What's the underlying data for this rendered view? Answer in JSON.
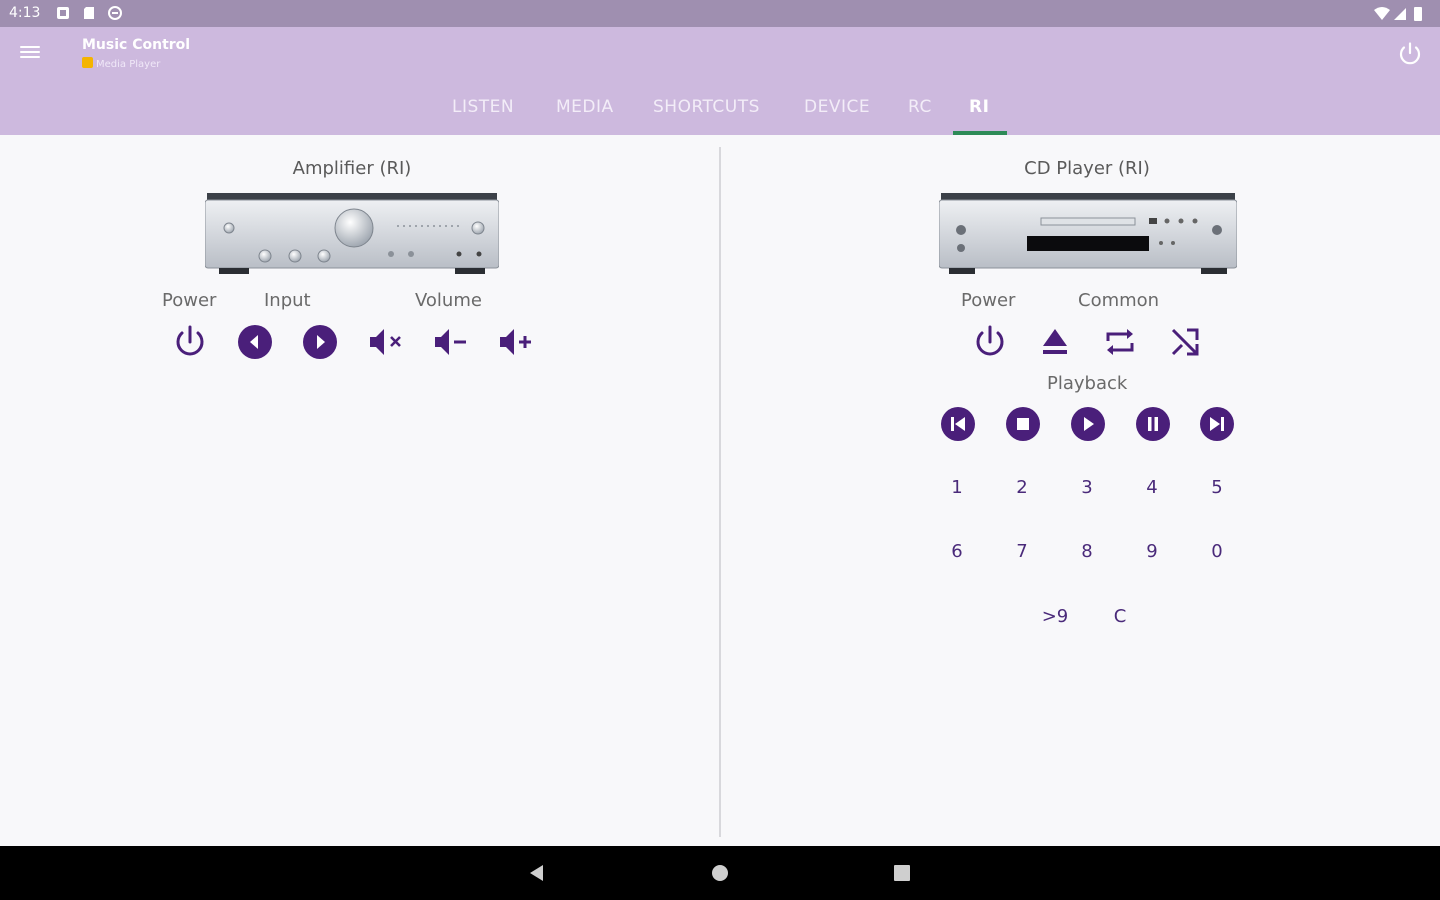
{
  "status": {
    "time": "4:13"
  },
  "app": {
    "title": "Music Control",
    "subtitle": "Media Player"
  },
  "tabs": [
    {
      "label": "LISTEN"
    },
    {
      "label": "MEDIA"
    },
    {
      "label": "SHORTCUTS"
    },
    {
      "label": "DEVICE"
    },
    {
      "label": "RC"
    },
    {
      "label": "RI",
      "active": true
    }
  ],
  "amplifier": {
    "title": "Amplifier (RI)",
    "labels": {
      "power": "Power",
      "input": "Input",
      "volume": "Volume"
    },
    "icons": [
      "power-icon",
      "input-previous-icon",
      "input-next-icon",
      "volume-mute-icon",
      "volume-down-icon",
      "volume-up-icon"
    ]
  },
  "cd_player": {
    "title": "CD Player (RI)",
    "labels": {
      "power": "Power",
      "common": "Common",
      "playback": "Playback"
    },
    "common_icons": [
      "power-icon",
      "eject-icon",
      "repeat-icon",
      "shuffle-icon"
    ],
    "playback_icons": [
      "skip-previous-icon",
      "stop-icon",
      "play-icon",
      "pause-icon",
      "skip-next-icon"
    ],
    "digits_row1": [
      "1",
      "2",
      "3",
      "4",
      "5"
    ],
    "digits_row2": [
      "6",
      "7",
      "8",
      "9",
      "0"
    ],
    "extra": [
      ">9",
      "C"
    ]
  },
  "colors": {
    "accent": "#4a1f7a",
    "appbar": "#cdb9de",
    "statusbar": "#9f8fb0",
    "tab_indicator": "#2e8b57"
  }
}
